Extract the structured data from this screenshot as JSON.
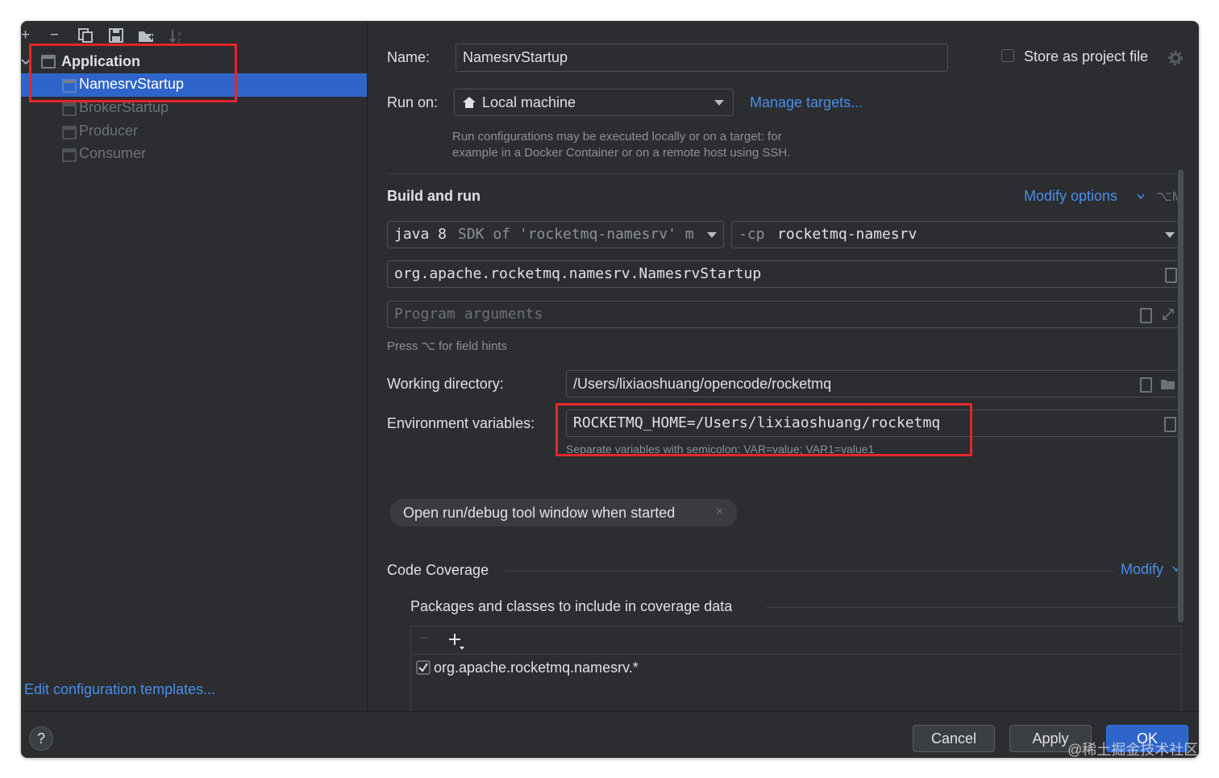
{
  "toolbar": {
    "add": "+",
    "remove": "−"
  },
  "tree": {
    "group": "Application",
    "items": [
      {
        "label": "NamesrvStartup"
      },
      {
        "label": "BrokerStartup"
      },
      {
        "label": "Producer"
      },
      {
        "label": "Consumer"
      }
    ]
  },
  "left_footer_link": "Edit configuration templates...",
  "name": {
    "label": "Name:",
    "value": "NamesrvStartup"
  },
  "store": {
    "label": "Store as project file"
  },
  "run_on": {
    "label": "Run on:",
    "value": "Local machine",
    "manage": "Manage targets...",
    "hint1": "Run configurations may be executed locally or on a target: for",
    "hint2": "example in a Docker Container or on a remote host using SSH."
  },
  "build": {
    "title": "Build and run",
    "modify": "Modify options",
    "shortcut": "⌥M",
    "jdk_prefix": "java 8",
    "jdk_rest": "SDK of 'rocketmq-namesrv' m",
    "cp_flag": "-cp",
    "cp_value": "rocketmq-namesrv",
    "main_class": "org.apache.rocketmq.namesrv.NamesrvStartup",
    "args_placeholder": "Program arguments",
    "hint": "Press ⌥ for field hints"
  },
  "workdir": {
    "label": "Working directory:",
    "value": "/Users/lixiaoshuang/opencode/rocketmq"
  },
  "env": {
    "label": "Environment variables:",
    "value": "ROCKETMQ_HOME=/Users/lixiaoshuang/rocketmq",
    "hint": "Separate variables with semicolon: VAR=value; VAR1=value1"
  },
  "chip": {
    "label": "Open run/debug tool window when started",
    "close": "×"
  },
  "coverage": {
    "title": "Code Coverage",
    "modify": "Modify",
    "packages_label": "Packages and classes to include in coverage data",
    "entry": "org.apache.rocketmq.namesrv.*"
  },
  "buttons": {
    "help": "?",
    "cancel": "Cancel",
    "apply": "Apply",
    "ok": "OK"
  },
  "watermark": "@稀土掘金技术社区"
}
